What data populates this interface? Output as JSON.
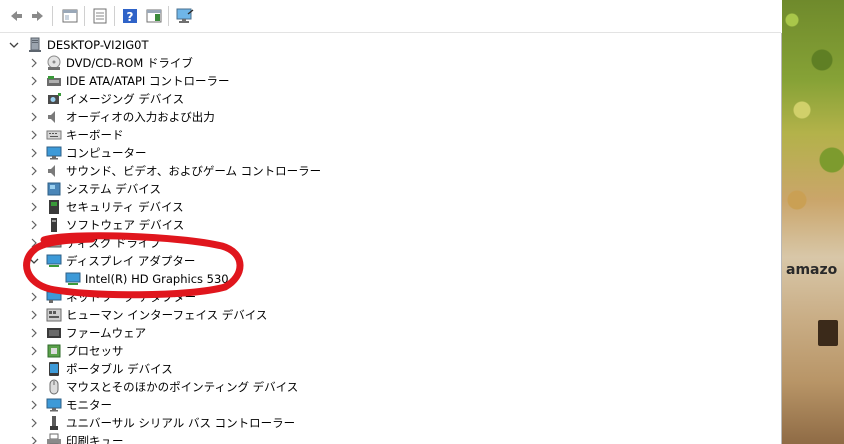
{
  "toolbar": {
    "buttons": [
      {
        "name": "back-arrow-icon"
      },
      {
        "name": "forward-arrow-icon"
      },
      {
        "name": "show-hide-console-tree-icon"
      },
      {
        "name": "properties-icon"
      },
      {
        "name": "help-icon"
      },
      {
        "name": "action-pane-icon"
      },
      {
        "name": "scan-hardware-changes-icon"
      }
    ]
  },
  "tree": {
    "root": {
      "label": "DESKTOP-VI2IG0T",
      "icon": "computer-icon"
    },
    "items": [
      {
        "label": "DVD/CD-ROM ドライブ",
        "icon": "dvd-drive-icon"
      },
      {
        "label": "IDE ATA/ATAPI コントローラー",
        "icon": "ide-controller-icon"
      },
      {
        "label": "イメージング デバイス",
        "icon": "camera-icon"
      },
      {
        "label": "オーディオの入力および出力",
        "icon": "speaker-icon"
      },
      {
        "label": "キーボード",
        "icon": "keyboard-icon"
      },
      {
        "label": "コンピューター",
        "icon": "monitor-icon"
      },
      {
        "label": "サウンド、ビデオ、およびゲーム コントローラー",
        "icon": "speaker-icon"
      },
      {
        "label": "システム デバイス",
        "icon": "system-devices-icon"
      },
      {
        "label": "セキュリティ デバイス",
        "icon": "security-device-icon"
      },
      {
        "label": "ソフトウェア デバイス",
        "icon": "software-device-icon"
      },
      {
        "label": "ディスク ドライブ",
        "icon": "disk-drive-icon"
      },
      {
        "label": "ディスプレイ アダプター",
        "icon": "display-adapter-icon",
        "expanded": true
      },
      {
        "label": "Intel(R) HD Graphics 530",
        "icon": "display-adapter-icon",
        "child": true
      },
      {
        "label": "ネットワーク アダプター",
        "icon": "network-adapter-icon"
      },
      {
        "label": "ヒューマン インターフェイス デバイス",
        "icon": "hid-icon"
      },
      {
        "label": "ファームウェア",
        "icon": "firmware-icon"
      },
      {
        "label": "プロセッサ",
        "icon": "processor-icon"
      },
      {
        "label": "ポータブル デバイス",
        "icon": "portable-device-icon"
      },
      {
        "label": "マウスとそのほかのポインティング デバイス",
        "icon": "mouse-icon"
      },
      {
        "label": "モニター",
        "icon": "monitor-icon"
      },
      {
        "label": "ユニバーサル シリアル バス コントローラー",
        "icon": "usb-icon"
      },
      {
        "label": "印刷キュー",
        "icon": "printer-icon"
      }
    ]
  },
  "background": {
    "brand_text": "amazo"
  },
  "colors": {
    "highlight_red": "#e0161d",
    "window_bg": "#ffffff"
  }
}
